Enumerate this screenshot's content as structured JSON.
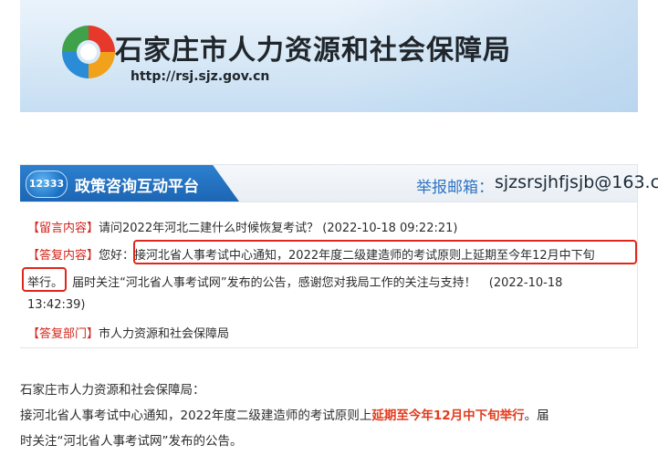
{
  "header": {
    "site_title": "石家庄市人力资源和社会保障局",
    "site_url": "http://rsj.sjz.gov.cn"
  },
  "platform": {
    "badge": "12333",
    "title": "政策咨询互动平台",
    "report_label": "举报邮箱：",
    "report_email": "sjzsrsjhfjsjb@163.c"
  },
  "message": {
    "question_tag": "【留言内容】",
    "question_text": "请问2022年河北二建什么时候恢复考试？",
    "question_time": "(2022-10-18 09:22:21)",
    "reply_tag": "【答复内容】",
    "reply_greeting": "您好：",
    "reply_highlight_line1": "接河北省人事考试中心通知，2022年度二级建造师的考试原则上延期至今年12月中下旬",
    "reply_highlight_line2": "举行。",
    "reply_rest": "届时关注“河北省人事考试网”发布的公告，感谢您对我局工作的关注与支持！",
    "reply_time_a": "(2022-10-18",
    "reply_time_b": "13:42:39)",
    "dept_tag": "【答复部门】",
    "dept_text": "市人力资源和社会保障局"
  },
  "summary": {
    "line1": "石家庄市人力资源和社会保障局：",
    "line2_prefix": "接河北省人事考试中心通知，2022年度二级建造师的考试原则上",
    "line2_highlight": "延期至今年12月中下旬举行",
    "line2_suffix": "。届",
    "line3": "时关注“河北省人事考试网”发布的公告。"
  }
}
